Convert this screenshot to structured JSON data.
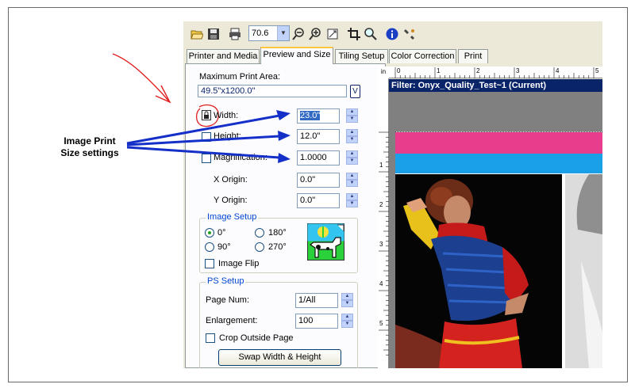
{
  "toolbar": {
    "zoom_value": "70.6",
    "icons": [
      "open-folder-icon",
      "save-icon",
      "print-icon",
      "zoom-out-icon",
      "zoom-in-icon",
      "fit-page-icon",
      "crop-icon",
      "search-icon",
      "info-icon",
      "tool-icon"
    ]
  },
  "tabs": [
    {
      "label": "Printer and Media",
      "active": false
    },
    {
      "label": "Preview and Size",
      "active": true
    },
    {
      "label": "Tiling Setup",
      "active": false
    },
    {
      "label": "Color Correction",
      "active": false
    },
    {
      "label": "Print",
      "active": false
    }
  ],
  "size": {
    "max_area_label": "Maximum Print Area:",
    "max_area_value": "49.5\"x1200.0\"",
    "max_area_button": "V",
    "width_label": "Width:",
    "width_value": "23.0\"",
    "height_label": "Height:",
    "height_value": "12.0\"",
    "magnification_label": "Magnification:",
    "magnification_value": "1.0000",
    "xorigin_label": "X Origin:",
    "xorigin_value": "0.0\"",
    "yorigin_label": "Y Origin:",
    "yorigin_value": "0.0\""
  },
  "image_setup": {
    "title": "Image Setup",
    "rot0": "0°",
    "rot180": "180°",
    "rot90": "90°",
    "rot270": "270°",
    "selected_rotation": "0°",
    "image_flip_label": "Image Flip"
  },
  "ps_setup": {
    "title": "PS Setup",
    "page_num_label": "Page Num:",
    "page_num_value": "1/All",
    "enlargement_label": "Enlargement:",
    "enlargement_value": "100",
    "crop_outside_label": "Crop Outside Page",
    "swap_button": "Swap Width & Height"
  },
  "preview": {
    "ruler_unit": "in",
    "ruler_top_numbers": [
      "0",
      "1",
      "2",
      "3",
      "4",
      "5"
    ],
    "ruler_left_numbers": [
      "1",
      "2",
      "3",
      "4",
      "5"
    ],
    "filter_title": "Filter: Onyx_Quality_Test~1 (Current)"
  },
  "annotation": {
    "line1": "Image Print",
    "line2": "Size settings",
    "arrow_color": "#1530c8",
    "hand_drawn_color": "#e02020"
  },
  "colors": {
    "magenta_bar": "#e83c8c",
    "cyan_bar": "#1aa0e6",
    "selection": "#316ac5"
  }
}
